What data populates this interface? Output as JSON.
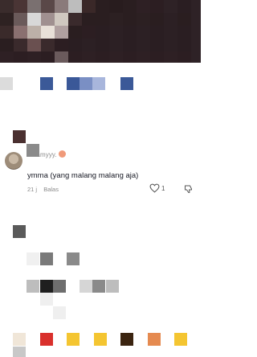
{
  "comment": {
    "username": "creamyyy.",
    "text": "ymma (yang malang malang aja)",
    "time": "21 j",
    "reply_label": "Balas",
    "like_count": "1"
  },
  "icons": {
    "avatar": "avatar-image",
    "like": "heart-icon",
    "dislike": "thumbs-down-icon",
    "badge": "emoji-badge-icon"
  },
  "colors": {
    "text": "#161823",
    "meta": "#8a8a8a"
  }
}
